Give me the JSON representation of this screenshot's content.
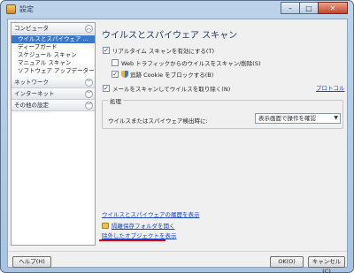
{
  "window": {
    "title": "設定"
  },
  "sidebar": {
    "sections": [
      {
        "label": "コンピュータ",
        "expanded": true,
        "items": [
          "ウイルスとスパイウェア ...",
          "ディープガード",
          "スケジュール スキャン",
          "マニュアル スキャン",
          "ソフトウェア アップデーター"
        ],
        "selected_index": 0
      },
      {
        "label": "ネットワーク",
        "expanded": false
      },
      {
        "label": "インターネット",
        "expanded": false
      },
      {
        "label": "その他の設定",
        "expanded": false
      }
    ]
  },
  "main": {
    "title": "ウイルスとスパイウェア スキャン",
    "options": {
      "realtime": {
        "label": "リアルタイム スキャンを有効にする(T)",
        "checked": true
      },
      "web_traffic": {
        "label": "Web トラフィックからのウイルスをスキャン/削除(S)",
        "checked": false
      },
      "tracking_cookie": {
        "label": "追跡 Cookie をブロックする(B)",
        "checked": true
      },
      "mail_scan": {
        "label": "メールをスキャンしてウイルスを取り除く(N)",
        "checked": true
      }
    },
    "protocol_link": "プロトコル",
    "processing": {
      "group_label": "処理",
      "row_label": "ウイルスまたはスパイウェア検出時に:",
      "select_value": "表示画面で操作を確認"
    },
    "links": {
      "history": "ウイルスとスパイウェアの履歴を表示",
      "quarantine": "隔離保存フォルダを開く",
      "excluded": "除外したオブジェクトを表示"
    }
  },
  "footer": {
    "help": "ヘルプ(H)",
    "ok": "OK(O)",
    "cancel": "キャンセル(C)"
  },
  "colors": {
    "highlight_underline": "#e60000",
    "selected_item": "#3b78c9",
    "link": "#1a45c4"
  }
}
